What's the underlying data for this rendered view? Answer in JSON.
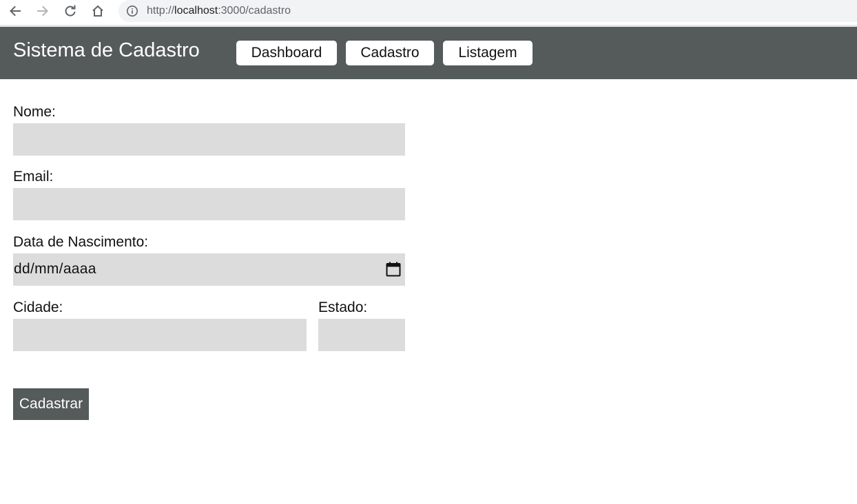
{
  "browser": {
    "url_prefix": "http://",
    "url_host": "localhost",
    "url_rest": ":3000/cadastro"
  },
  "header": {
    "title": "Sistema de Cadastro",
    "menu": [
      {
        "label": "Dashboard"
      },
      {
        "label": "Cadastro"
      },
      {
        "label": "Listagem"
      }
    ]
  },
  "form": {
    "nome_label": "Nome:",
    "email_label": "Email:",
    "nascimento_label": "Data de Nascimento:",
    "nascimento_placeholder": "dd/mm/aaaa",
    "cidade_label": "Cidade:",
    "estado_label": "Estado:",
    "submit_label": "Cadastrar"
  },
  "colors": {
    "header_bg": "#555a5a",
    "input_bg": "#dcdcdc",
    "button_bg": "#555a5a"
  },
  "icons": {
    "back": "arrow-left-icon",
    "forward": "arrow-right-icon",
    "reload": "reload-icon",
    "home": "home-icon",
    "info": "info-icon",
    "calendar": "calendar-icon"
  }
}
